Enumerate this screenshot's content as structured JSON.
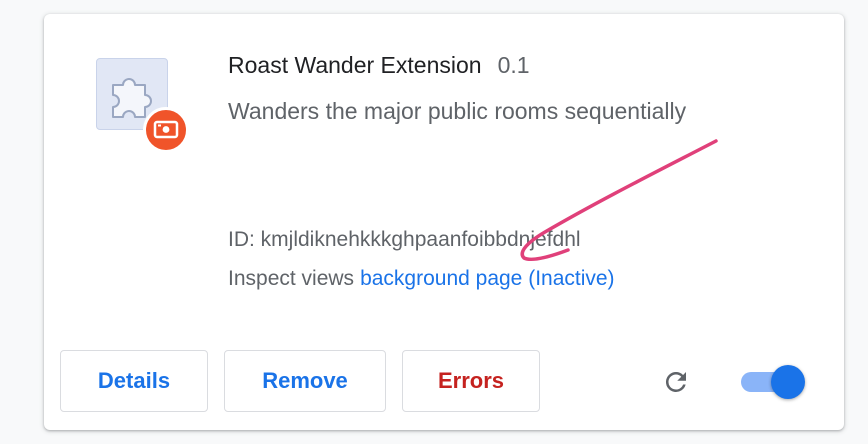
{
  "extension": {
    "name": "Roast Wander Extension",
    "version": "0.1",
    "description": "Wanders the major public rooms sequentially",
    "id_label": "ID: kmjldiknehkkkghpaanfoibbdnjefdhl",
    "inspect_label": "Inspect views",
    "inspect_link": "background page (Inactive)",
    "icon": "puzzle-piece-icon",
    "badge_icon": "unpacked-badge-icon"
  },
  "buttons": {
    "details": "Details",
    "remove": "Remove",
    "errors": "Errors"
  },
  "controls": {
    "reload_icon": "reload-icon",
    "enabled": true
  },
  "colors": {
    "link": "#1a73e8",
    "errors": "#c5221f",
    "badge": "#f0542a",
    "annotation_stroke": "#e0407a",
    "toggle_track": "#8ab4f8",
    "toggle_knob": "#1a73e8"
  }
}
